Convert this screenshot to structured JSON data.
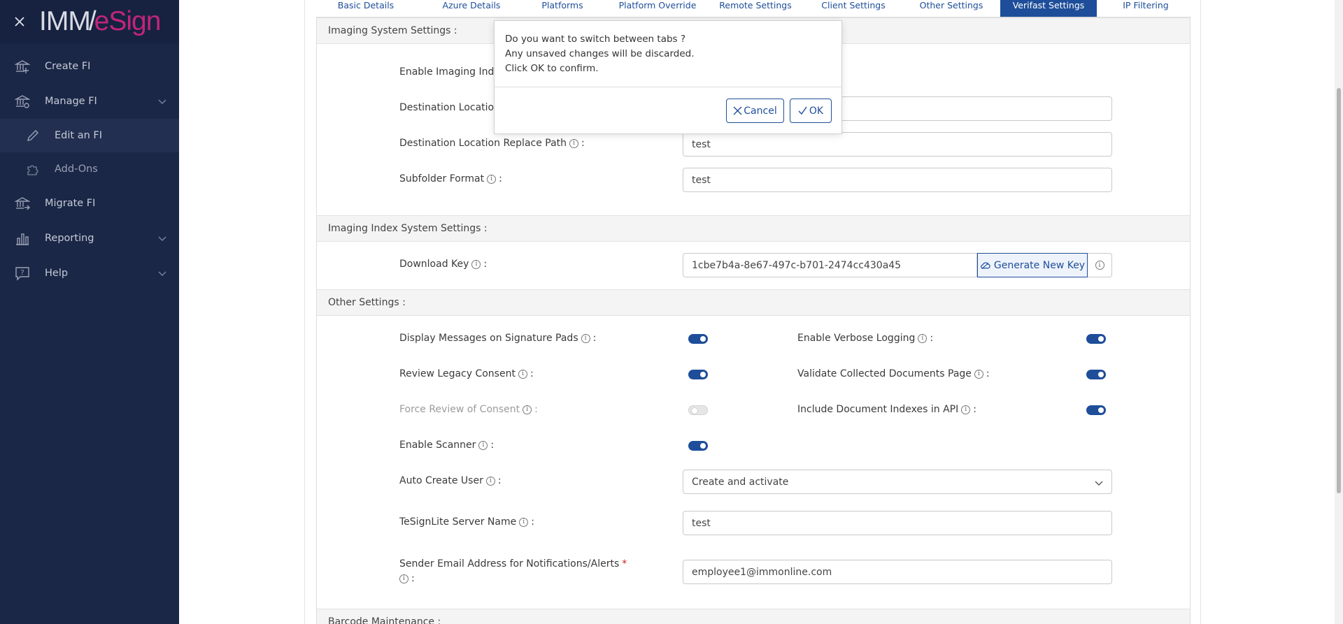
{
  "brand": {
    "imm": "IMM",
    "slash": "/",
    "esign": "eSign"
  },
  "sidebar": {
    "items": [
      {
        "label": "Create FI",
        "icon": "bank-icon"
      },
      {
        "label": "Manage FI",
        "icon": "bank-gear-icon"
      },
      {
        "label": "Edit an FI",
        "icon": "pencil-icon"
      },
      {
        "label": "Add-Ons",
        "icon": "puzzle-icon"
      },
      {
        "label": "Migrate FI",
        "icon": "bank-arrow-icon"
      },
      {
        "label": "Reporting",
        "icon": "bar-chart-icon"
      },
      {
        "label": "Help",
        "icon": "help-chat-icon"
      }
    ]
  },
  "tabs": [
    {
      "label": "Basic Details",
      "active": false
    },
    {
      "label": "Azure Details",
      "active": false
    },
    {
      "label": "Platforms",
      "active": false
    },
    {
      "label": "Platform Override",
      "active": false
    },
    {
      "label": "Remote Settings",
      "active": false
    },
    {
      "label": "Client Settings",
      "active": false
    },
    {
      "label": "Other Settings",
      "active": false
    },
    {
      "label": "Verifast Settings",
      "active": true
    },
    {
      "label": "IP Filtering",
      "active": false
    }
  ],
  "imaging_system": {
    "header": "Imaging System Settings :",
    "enable_imaging_index_label": "Enable Imaging Index",
    "destination_location_label": "Destination Location",
    "destination_replace_path_label": "Destination Location Replace Path",
    "destination_replace_path_value": "test",
    "subfolder_format_label": "Subfolder Format",
    "subfolder_format_value": "test"
  },
  "imaging_index": {
    "header": "Imaging Index System Settings :",
    "download_key_label": "Download Key",
    "download_key_value": "1cbe7b4a-8e67-497c-b701-2474cc430a45",
    "generate_button": "Generate New Key"
  },
  "other_settings": {
    "header": "Other Settings :",
    "display_messages_label": "Display Messages on Signature Pads",
    "review_legacy_label": "Review Legacy Consent",
    "force_review_label": "Force Review of Consent",
    "enable_scanner_label": "Enable Scanner",
    "enable_verbose_label": "Enable Verbose Logging",
    "validate_docs_label": "Validate Collected Documents Page",
    "include_indexes_label": "Include Document Indexes in API",
    "auto_create_label": "Auto Create User",
    "auto_create_value": "Create and activate",
    "tesignlite_label": "TeSignLite Server Name",
    "tesignlite_value": "test",
    "sender_email_label": "Sender Email Address for Notifications/Alerts",
    "sender_email_required": "*",
    "sender_email_value": "employee1@immonline.com",
    "colon": ":"
  },
  "barcode": {
    "header": "Barcode Maintenance :"
  },
  "toggles": {
    "display_messages": true,
    "review_legacy": true,
    "force_review": false,
    "enable_scanner": true,
    "enable_verbose": true,
    "validate_docs": true,
    "include_indexes": true
  },
  "modal": {
    "line1": "Do you want to switch between tabs ?",
    "line2": "Any unsaved changes will be discarded.",
    "line3": "Click OK to confirm.",
    "cancel_label": "Cancel",
    "ok_label": "OK"
  },
  "colors": {
    "sidebar_bg": "#1a2746",
    "accent": "#1e4e9a",
    "brand_pink": "#c2247a",
    "required": "#d12020"
  }
}
